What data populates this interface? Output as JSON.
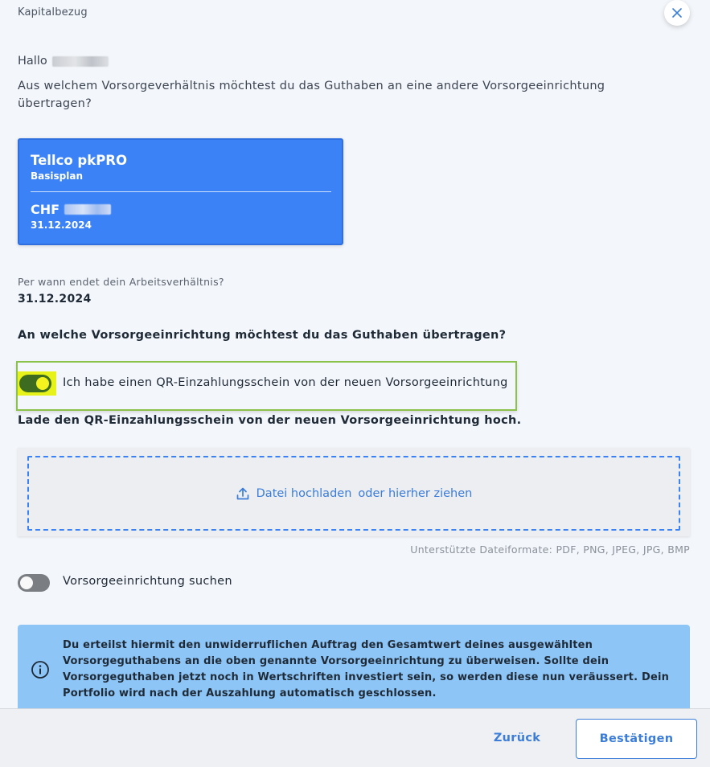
{
  "dialog": {
    "title": "Kapitalbezug",
    "close_icon": "close-icon"
  },
  "greeting": {
    "text": "Hallo"
  },
  "question": "Aus welchem Vorsorgeverhältnis möchtest du das Guthaben an eine andere Vorsorgeeinrichtung übertragen?",
  "account": {
    "name": "Tellco pkPRO",
    "plan": "Basisplan",
    "currency": "CHF",
    "date": "31.12.2024",
    "color": "#3b82f6"
  },
  "employment_end": {
    "label": "Per wann endet dein Arbeitsverhältnis?",
    "value": "31.12.2024"
  },
  "target_heading": "An welche Vorsorgeeinrichtung möchtest du das Guthaben übertragen?",
  "qr_toggle": {
    "label": "Ich habe einen QR-Einzahlungsschein von der neuen Vorsorgeeinrichtung",
    "checked": true
  },
  "upload": {
    "instruction": "Lade den QR-Einzahlungsschein von der neuen Vorsorgeeinrichtung hoch.",
    "upload_text": "Datei hochladen",
    "drag_text": "oder hierher ziehen",
    "icon": "upload-icon",
    "formats": "Unterstützte Dateiformate: PDF, PNG, JPEG, JPG, BMP"
  },
  "search_toggle": {
    "label": "Vorsorgeeinrichtung suchen",
    "checked": false
  },
  "info": {
    "icon": "info-icon",
    "text": "Du erteilst hiermit den unwiderruflichen Auftrag den Gesamtwert deines ausgewählten Vorsorgeguthabens an die oben genannte Vorsorgeeinrichtung zu überweisen. Sollte dein Vorsorgeguthaben jetzt noch in Wertschriften investiert sein, so werden diese nun veräussert. Dein Portfolio wird nach der Auszahlung automatisch geschlossen."
  },
  "footer": {
    "back_label": "Zurück",
    "confirm_label": "Bestätigen"
  },
  "colors": {
    "accent": "#3b7dd8",
    "toggle_on": "#3d6b1f",
    "info_bg": "#8ec5f7"
  }
}
